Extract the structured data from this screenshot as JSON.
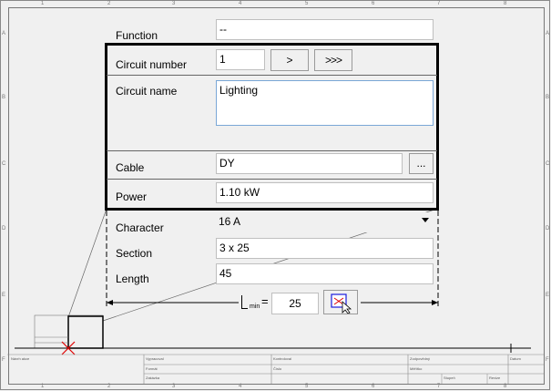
{
  "frame": {
    "cols": [
      "1",
      "2",
      "3",
      "4",
      "5",
      "6",
      "7",
      "8"
    ],
    "rows": [
      "A",
      "B",
      "C",
      "D",
      "E",
      "F"
    ]
  },
  "form": {
    "function": {
      "label": "Function",
      "value": "--"
    },
    "circuit_number": {
      "label": "Circuit number",
      "value": "1",
      "next_label": ">",
      "fast_next_label": ">>>"
    },
    "circuit_name": {
      "label": "Circuit name",
      "value": "Lighting"
    },
    "cable": {
      "label": "Cable",
      "value": "DY",
      "browse_label": "..."
    },
    "power": {
      "label": "Power",
      "value": "1.10 kW"
    },
    "character": {
      "label": "Character",
      "value": "16 A"
    },
    "section": {
      "label": "Section",
      "value": "3 x 25"
    },
    "length": {
      "label": "Length",
      "value": "45"
    },
    "lmin": {
      "symbol": "L",
      "subscript": "min",
      "equals": "=",
      "value": "25"
    }
  },
  "title_block": {
    "texts": [
      "Návrh akce",
      "Vypracoval",
      "Kontroloval",
      "Zodpovědný",
      "Datum",
      "Formát",
      "Číslo",
      "Měřítko",
      "Zakázka",
      "Stupeň",
      "Revize"
    ]
  },
  "colors": {
    "background": "#f0f0f0",
    "field_border": "#bfbfbf",
    "focus_border": "#7aa7d6",
    "marker_red": "#e00000",
    "pick_blue": "#1a1adc"
  }
}
